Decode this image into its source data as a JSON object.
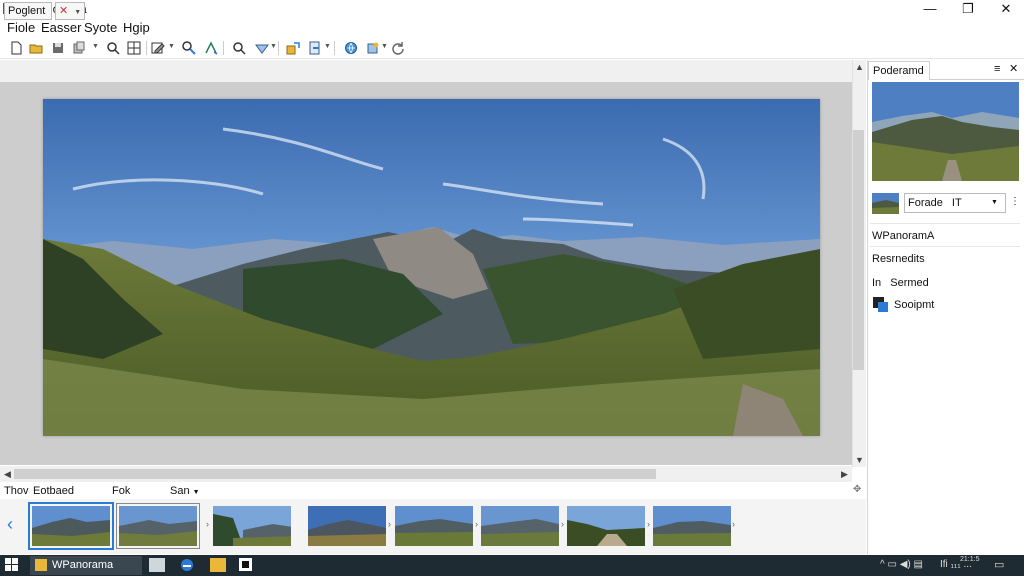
{
  "window": {
    "title": "WPanorama",
    "min_glyph": "—",
    "max_glyph": "❐",
    "close_glyph": "✕"
  },
  "menu": [
    "Fiole",
    "Easser",
    "Syote",
    "Hgip"
  ],
  "toolbar_icons": [
    "new-file-icon",
    "open-folder-icon",
    "save-icon",
    "copy-icon",
    "find-icon",
    "grid-icon",
    "edit-icon",
    "zoom-icon",
    "text-icon",
    "search-icon",
    "shape-icon",
    "export-icon",
    "import-icon",
    "globe-icon",
    "settings-icon",
    "refresh-icon"
  ],
  "subbar": {
    "mode": "Poglent",
    "close_label": "✕"
  },
  "filmbar": {
    "col1": "Thov",
    "col2": "Eotbaed",
    "col3": "Fok",
    "col4": "San"
  },
  "right_panel": {
    "tab_label": "Poderamd",
    "layer_name": "Forade",
    "layer_value": "IT",
    "item_title": "WPanoramA",
    "item_label": "Resrnedits",
    "item_prefix": "In",
    "item_status": "Sermed",
    "item_source": "Sooipmt"
  },
  "taskbar": {
    "app_label": "WPanorama",
    "tray_text": "Ifi ₁₁₁ ...",
    "time_text": "21:1:5"
  },
  "colors": {
    "accent": "#2b7bd6",
    "taskbar": "#1f2b33",
    "canvas": "#cdcdcd"
  }
}
